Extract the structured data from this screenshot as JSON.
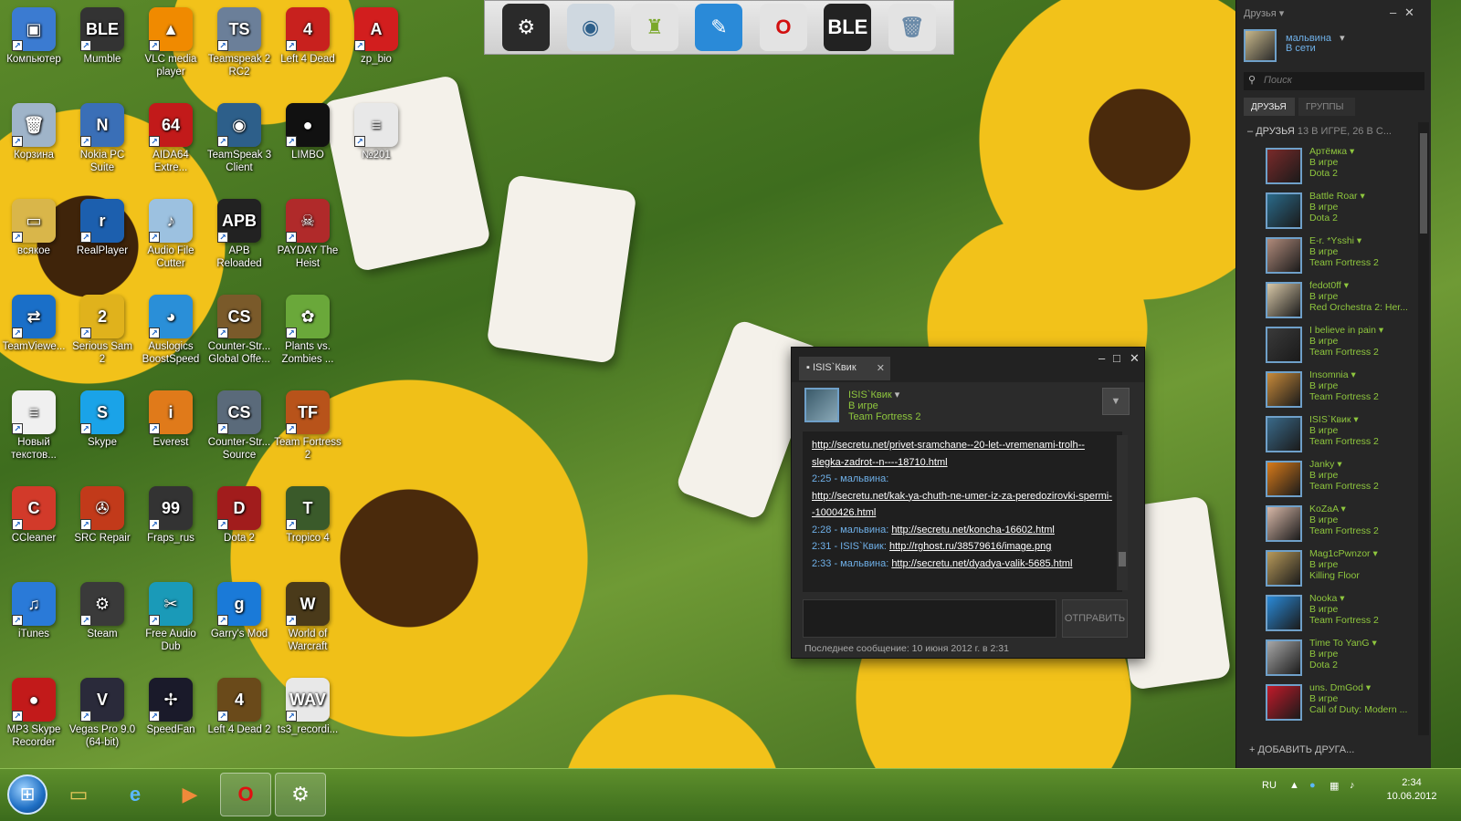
{
  "desktop": {
    "icons": [
      {
        "label": "Компьютер",
        "color": "#3b7bd1",
        "glyph": "▣"
      },
      {
        "label": "Mumble",
        "color": "#333333",
        "glyph": "BLE"
      },
      {
        "label": "VLC media player",
        "color": "#f08a00",
        "glyph": "▲"
      },
      {
        "label": "Teamspeak 2 RC2",
        "color": "#6b7f99",
        "glyph": "TS"
      },
      {
        "label": "Left 4 Dead",
        "color": "#c8211e",
        "glyph": "4"
      },
      {
        "label": "zp_bio",
        "color": "#d21e1e",
        "glyph": "A"
      },
      {
        "label": "Корзина",
        "color": "#9fb4c9",
        "glyph": "🗑"
      },
      {
        "label": "Nokia PC Suite",
        "color": "#3a6fb7",
        "glyph": "N"
      },
      {
        "label": "AIDA64 Extre...",
        "color": "#c21a1a",
        "glyph": "64"
      },
      {
        "label": "TeamSpeak 3 Client",
        "color": "#2d5f8a",
        "glyph": "◉"
      },
      {
        "label": "LIMBO",
        "color": "#111111",
        "glyph": "●"
      },
      {
        "label": "№201",
        "color": "#e8e8e8",
        "glyph": "≡"
      },
      {
        "label": "всякое",
        "color": "#d9b64a",
        "glyph": "▭"
      },
      {
        "label": "RealPlayer",
        "color": "#1c5fae",
        "glyph": "r"
      },
      {
        "label": "Audio File Cutter",
        "color": "#9cc1e0",
        "glyph": "♪"
      },
      {
        "label": "APB Reloaded",
        "color": "#222222",
        "glyph": "APB"
      },
      {
        "label": "PAYDAY The Heist",
        "color": "#b02a2a",
        "glyph": "☠"
      },
      {
        "label": "TeamViewe...",
        "color": "#1a6fc8",
        "glyph": "⇄"
      },
      {
        "label": "Serious Sam 2",
        "color": "#e0b21c",
        "glyph": "2"
      },
      {
        "label": "Auslogics BoostSpeed",
        "color": "#2a8fd8",
        "glyph": "◕"
      },
      {
        "label": "Counter-Str... Global Offe...",
        "color": "#7a5a2a",
        "glyph": "CS"
      },
      {
        "label": "Plants vs. Zombies ...",
        "color": "#6aa83a",
        "glyph": "✿"
      },
      {
        "label": "Новый текстов...",
        "color": "#f0f0f0",
        "glyph": "≡"
      },
      {
        "label": "Skype",
        "color": "#1aa3e8",
        "glyph": "S"
      },
      {
        "label": "Everest",
        "color": "#e07a1a",
        "glyph": "i"
      },
      {
        "label": "Counter-Str... Source",
        "color": "#5a6a7a",
        "glyph": "CS"
      },
      {
        "label": "Team Fortress 2",
        "color": "#b8531a",
        "glyph": "TF"
      },
      {
        "label": "CCleaner",
        "color": "#d23a2a",
        "glyph": "C"
      },
      {
        "label": "SRC Repair",
        "color": "#c23a1a",
        "glyph": "✇"
      },
      {
        "label": "Fraps_rus",
        "color": "#333333",
        "glyph": "99"
      },
      {
        "label": "Dota 2",
        "color": "#a11c1c",
        "glyph": "D"
      },
      {
        "label": "Tropico 4",
        "color": "#3a5a2a",
        "glyph": "T"
      },
      {
        "label": "iTunes",
        "color": "#2a7ad8",
        "glyph": "♫"
      },
      {
        "label": "Steam",
        "color": "#3a3a3a",
        "glyph": "⚙"
      },
      {
        "label": "Free Audio Dub",
        "color": "#1a9ab8",
        "glyph": "✂"
      },
      {
        "label": "Garry's Mod",
        "color": "#1a7ad8",
        "glyph": "g"
      },
      {
        "label": "World of Warcraft",
        "color": "#4a3a1a",
        "glyph": "W"
      },
      {
        "label": "MP3 Skype Recorder",
        "color": "#c21a1a",
        "glyph": "●"
      },
      {
        "label": "Vegas Pro 9.0 (64-bit)",
        "color": "#2a2a3a",
        "glyph": "V"
      },
      {
        "label": "SpeedFan",
        "color": "#1a1a2a",
        "glyph": "✢"
      },
      {
        "label": "Left 4 Dead 2",
        "color": "#6a4a1a",
        "glyph": "4"
      },
      {
        "label": "ts3_recordi...",
        "color": "#e8e8e8",
        "glyph": "WAV"
      }
    ]
  },
  "dock": {
    "items": [
      {
        "name": "steam-dock",
        "glyph": "⚙",
        "color": "#2a2a2a",
        "fg": "#ffffff"
      },
      {
        "name": "teamspeak-dock",
        "glyph": "◉",
        "color": "#cfd8e0",
        "fg": "#2d5f8a"
      },
      {
        "name": "robot-dock",
        "glyph": "♜",
        "color": "#e3e3e3",
        "fg": "#7aa82a"
      },
      {
        "name": "eraser-dock",
        "glyph": "✎",
        "color": "#2a8ad8",
        "fg": "#ffffff"
      },
      {
        "name": "opera-dock",
        "glyph": "O",
        "color": "#e3e3e3",
        "fg": "#d21010"
      },
      {
        "name": "mumble-dock",
        "glyph": "BLE",
        "color": "#222222",
        "fg": "#ffffff"
      },
      {
        "name": "recycle-dock",
        "glyph": "🗑",
        "color": "#e3e3e3",
        "fg": "#6a8aa8"
      }
    ]
  },
  "chat": {
    "tab_title": "ISIS`Квик",
    "contact_name": "ISIS`Квик",
    "contact_status": "В игре",
    "contact_game": "Team Fortress 2",
    "messages": [
      {
        "time": "",
        "sender": "",
        "link": "http://secretu.net/privet-sramchane--20-let--vremenami-trolh--slegka-zadrot--n----18710.html"
      },
      {
        "time": "2:25",
        "sender": "мальвина",
        "link": ""
      },
      {
        "time": "",
        "sender": "",
        "link": "http://secretu.net/kak-ya-chuth-ne-umer-iz-za-peredozirovki-spermi--1000426.html"
      },
      {
        "time": "2:28",
        "sender": "мальвина",
        "link": "http://secretu.net/koncha-16602.html"
      },
      {
        "time": "2:31",
        "sender": "ISIS`Квик",
        "link": "http://rghost.ru/38579616/image.png"
      },
      {
        "time": "2:33",
        "sender": "мальвина",
        "link": "http://secretu.net/dyadya-valik-5685.html"
      }
    ],
    "send_label": "ОТПРАВИТЬ",
    "last_message": "Последнее сообщение: 10 июня 2012 г. в 2:31"
  },
  "friends": {
    "panel_title": "Друзья",
    "me_name": "мальвина",
    "me_status": "В сети",
    "search_placeholder": "Поиск",
    "tab_friends": "ДРУЗЬЯ",
    "tab_groups": "ГРУППЫ",
    "group_title": "ДРУЗЬЯ",
    "group_counts": "13 В ИГРЕ, 26 В С...",
    "list": [
      {
        "name": "Артёмка",
        "status": "В игре",
        "game": "Dota 2",
        "color": "#7a2a2a"
      },
      {
        "name": "Battle Roar",
        "status": "В игре",
        "game": "Dota 2",
        "color": "#2a6a8a"
      },
      {
        "name": "E-r. *Ysshi",
        "status": "В игре",
        "game": "Team Fortress 2",
        "color": "#b08a7a"
      },
      {
        "name": "fedot0ff",
        "status": "В игре",
        "game": "Red Orchestra 2: Her...",
        "color": "#d8c8a8"
      },
      {
        "name": "I believe in pain",
        "status": "В игре",
        "game": "Team Fortress 2",
        "color": "#3a3a3a"
      },
      {
        "name": "Insomnia",
        "status": "В игре",
        "game": "Team Fortress 2",
        "color": "#c88a3a"
      },
      {
        "name": "ISIS`Квик",
        "status": "В игре",
        "game": "Team Fortress 2",
        "color": "#3a6a8a"
      },
      {
        "name": "Janky",
        "status": "В игре",
        "game": "Team Fortress 2",
        "color": "#d87a1a"
      },
      {
        "name": "KoZaA",
        "status": "В игре",
        "game": "Team Fortress 2",
        "color": "#d8b8a8"
      },
      {
        "name": "Mag1cPwnzor",
        "status": "В игре",
        "game": "Killing Floor",
        "color": "#b89a5a"
      },
      {
        "name": "Nooka",
        "status": "В игре",
        "game": "Team Fortress 2",
        "color": "#2a8ad8"
      },
      {
        "name": "Time To YanG",
        "status": "В игре",
        "game": "Dota 2",
        "color": "#a8a8a8"
      },
      {
        "name": "uns. DmGod",
        "status": "В игре",
        "game": "Call of Duty: Modern ...",
        "color": "#c21a2a"
      }
    ],
    "add_friend": "ДОБАВИТЬ ДРУГА..."
  },
  "taskbar": {
    "lang": "RU",
    "time": "2:34",
    "date": "10.06.2012"
  }
}
